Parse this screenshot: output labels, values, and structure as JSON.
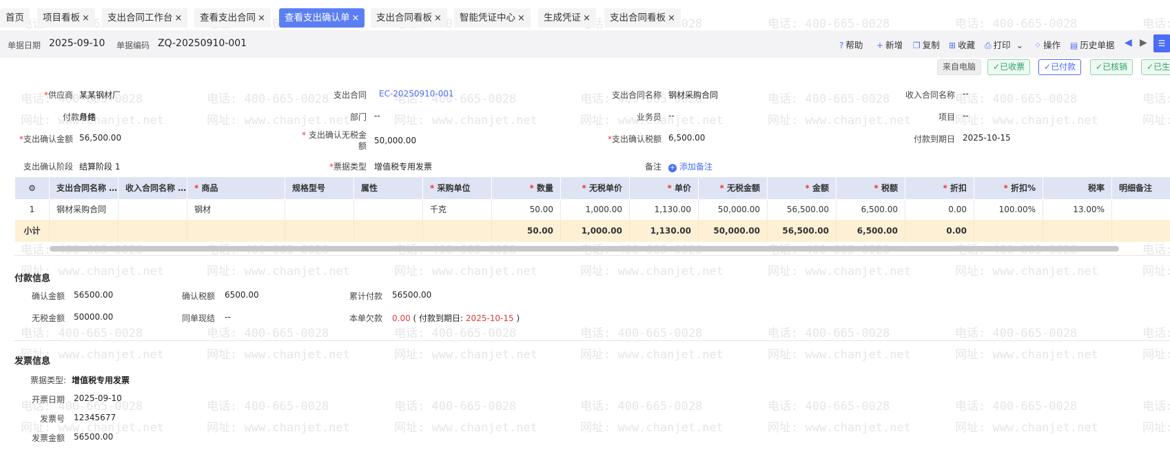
{
  "watermark": {
    "phone": "电话: 400-665-0028",
    "site": "网址: www.chanjet.net"
  },
  "tabs": [
    {
      "label": "首页",
      "closable": false
    },
    {
      "label": "项目看板",
      "closable": true
    },
    {
      "label": "支出合同工作台",
      "closable": true
    },
    {
      "label": "查看支出合同",
      "closable": true
    },
    {
      "label": "查看支出确认单",
      "closable": true,
      "active": true
    },
    {
      "label": "支出合同看板",
      "closable": true
    },
    {
      "label": "智能凭证中心",
      "closable": true
    },
    {
      "label": "生成凭证",
      "closable": true
    },
    {
      "label": "支出合同看板",
      "closable": true
    }
  ],
  "close_glyph": "×",
  "header": {
    "date_label": "单据日期",
    "date_value": "2025-09-10",
    "code_label": "单据编码",
    "code_value": "ZQ-20250910-001"
  },
  "toolbar": {
    "help": "帮助",
    "add": "新增",
    "copy": "复制",
    "collect": "收藏",
    "print": "打印",
    "operate": "操作",
    "history": "历史单据"
  },
  "status": {
    "source": "来自电脑",
    "collected": "已收票",
    "paid": "已付款",
    "verified": "已核销",
    "generated": "已生"
  },
  "form": {
    "supplier_label": "供应商",
    "supplier_value": "某某钢材厂",
    "contract_label": "支出合同",
    "contract_value": "EC-20250910-001",
    "contract_name_label": "支出合同名称",
    "contract_name_value": "钢材采购合同",
    "income_contract_label": "收入合同名称",
    "income_contract_value": "--",
    "pay_terms_label": "付款条件",
    "pay_terms_value": "月结",
    "dept_label": "部门",
    "dept_value": "--",
    "staff_label": "业务员",
    "staff_value": "--",
    "project_label": "项目",
    "project_value": "--",
    "amount_label": "支出确认金额",
    "amount_value": "56,500.00",
    "notax_label_1": "支出确认无税金",
    "notax_label_2": "额",
    "notax_value": "50,000.00",
    "tax_label": "支出确认税额",
    "tax_value": "6,500.00",
    "due_label": "付款到期日",
    "due_value": "2025-10-15",
    "stage_label": "支出确认阶段",
    "stage_value": "结算阶段 1",
    "bill_type_label": "票据类型",
    "bill_type_value": "增值税专用发票",
    "remark_label": "备注",
    "remark_add": "添加备注"
  },
  "grid": {
    "headers": [
      "支出合同名称 …",
      "收入合同名称 …",
      "商品",
      "规格型号",
      "属性",
      "采购单位",
      "数量",
      "无税单价",
      "单价",
      "无税金额",
      "金额",
      "税额",
      "折扣",
      "折扣%",
      "税率",
      "明细备注"
    ],
    "row": [
      "1",
      "钢材采购合同",
      "",
      "钢材",
      "",
      "",
      "千克",
      "50.00",
      "1,000.00",
      "1,130.00",
      "50,000.00",
      "56,500.00",
      "6,500.00",
      "0.00",
      "100.00%",
      "13.00%",
      ""
    ],
    "subtotal_label": "小计",
    "subtotal": [
      "50.00",
      "1,000.00",
      "1,130.00",
      "50,000.00",
      "56,500.00",
      "6,500.00",
      "0.00"
    ]
  },
  "payment": {
    "title": "付款信息",
    "confirm_amount_label": "确认金额",
    "confirm_amount": "56500.00",
    "confirm_tax_label": "确认税额",
    "confirm_tax": "6500.00",
    "total_paid_label": "累计付款",
    "total_paid": "56500.00",
    "notax_label": "无税金额",
    "notax": "50000.00",
    "cash_label": "同单现结",
    "cash": "--",
    "owe_label": "本单欠款",
    "owe": "0.00",
    "owe_due_prefix": "( 付款到期日:",
    "owe_due": "2025-10-15",
    "owe_due_suffix": ")"
  },
  "invoice": {
    "title": "发票信息",
    "type_label": "票据类型:",
    "type_value": "增值税专用发票",
    "date_label": "开票日期",
    "date_value": "2025-09-10",
    "no_label": "发票号",
    "no_value": "12345677",
    "amount_label": "发票金额",
    "amount_value": "56500.00"
  },
  "colors": {
    "accent": "#5b7ff2",
    "required": "#e33333",
    "pill_green": "#2fa36b",
    "owe_red": "#e53935"
  }
}
